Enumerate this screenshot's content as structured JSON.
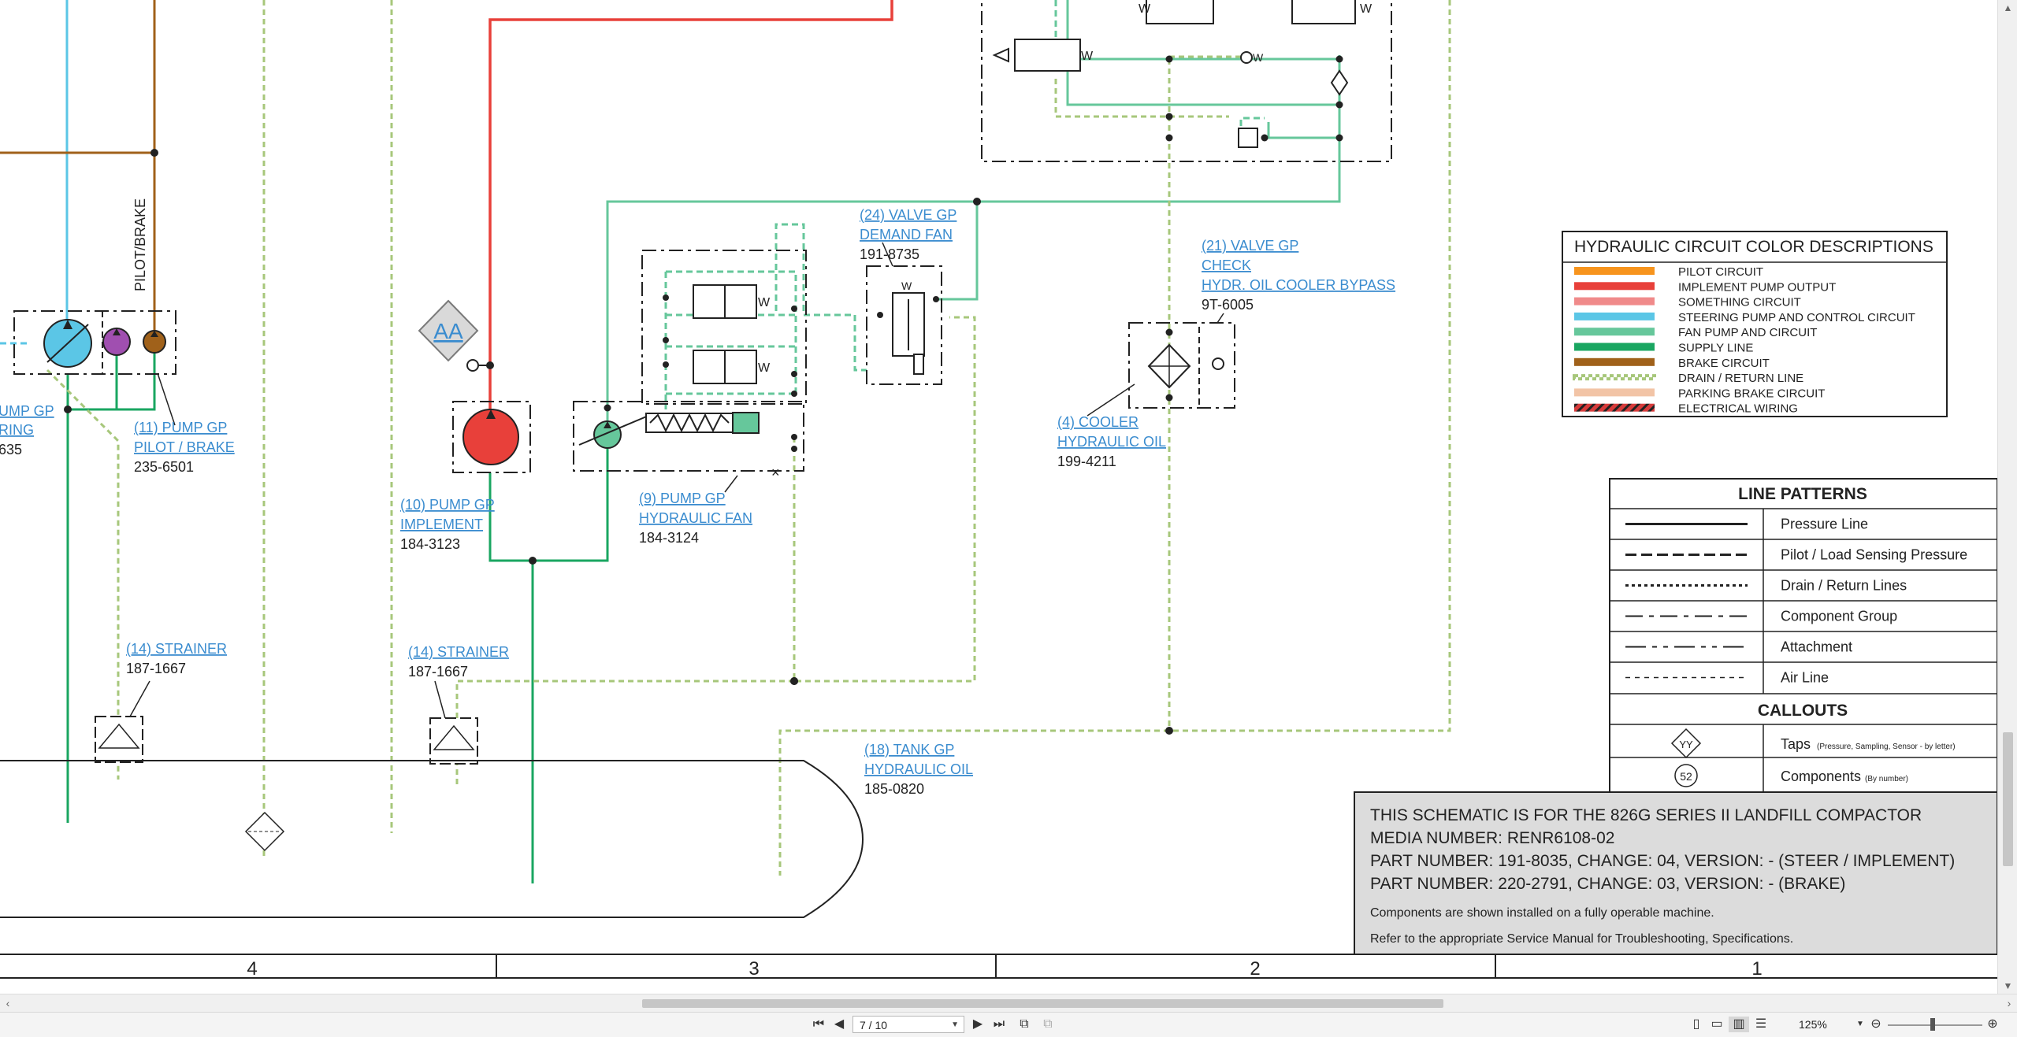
{
  "colors": {
    "pilot": "#f7941d",
    "implement": "#e8403a",
    "something": "#f08a8a",
    "steering": "#5bc6e6",
    "fan": "#66c79b",
    "supply": "#1aa661",
    "brake": "#a0611a",
    "drain": "#a7c77b",
    "parking": "#f2c4a6",
    "electrical": "#d73b3b",
    "link": "#3a8ccf"
  },
  "components": {
    "pump_steering": {
      "name1": "UMP GP",
      "name2": "RING",
      "part": "635"
    },
    "pump_pilot": {
      "name1": "(11) PUMP GP",
      "name2": "PILOT / BRAKE",
      "part": "235-6501"
    },
    "pilot_brake_label": "PILOT/BRAKE",
    "pump_implement": {
      "name1": "(10) PUMP GP",
      "name2": "IMPLEMENT",
      "part": "184-3123"
    },
    "pump_fan": {
      "name1": "(9) PUMP GP",
      "name2": "HYDRAULIC FAN",
      "part": "184-3124"
    },
    "valve_fan": {
      "name1": "(24) VALVE GP",
      "name2": "DEMAND FAN",
      "part": "191-8735"
    },
    "valve_check": {
      "name1": "(21) VALVE GP",
      "name2": "CHECK",
      "name3": "HYDR. OIL COOLER BYPASS",
      "part": "9T-6005"
    },
    "cooler": {
      "name1": "(4) COOLER",
      "name2": "HYDRAULIC OIL",
      "part": "199-4211"
    },
    "strainer_a": {
      "name1": "(14) STRAINER",
      "part": "187-1667"
    },
    "strainer_b": {
      "name1": "(14) STRAINER",
      "part": "187-1667"
    },
    "tank": {
      "name1": "(18) TANK GP",
      "name2": "HYDRAULIC OIL",
      "part": "185-0820"
    },
    "tap_aa": "AA"
  },
  "color_legend": {
    "title": "HYDRAULIC CIRCUIT COLOR DESCRIPTIONS",
    "items": [
      {
        "label": "PILOT CIRCUIT",
        "color": "#f7941d"
      },
      {
        "label": "IMPLEMENT PUMP OUTPUT",
        "color": "#e8403a"
      },
      {
        "label": "SOMETHING CIRCUIT",
        "color": "#f08a8a"
      },
      {
        "label": "STEERING PUMP AND CONTROL CIRCUIT",
        "color": "#5bc6e6"
      },
      {
        "label": "FAN PUMP AND CIRCUIT",
        "color": "#66c79b"
      },
      {
        "label": "SUPPLY LINE",
        "color": "#1aa661"
      },
      {
        "label": "BRAKE CIRCUIT",
        "color": "#a0611a"
      },
      {
        "label": "DRAIN / RETURN LINE",
        "color": "#a7c77b"
      },
      {
        "label": "PARKING BRAKE CIRCUIT",
        "color": "#f2c4a6"
      },
      {
        "label": "ELECTRICAL WIRING",
        "color": "#d73b3b"
      }
    ]
  },
  "line_patterns": {
    "title": "LINE PATTERNS",
    "items": [
      "Pressure Line",
      "Pilot / Load Sensing Pressure",
      "Drain / Return Lines",
      "Component Group",
      "Attachment",
      "Air Line"
    ],
    "callouts_title": "CALLOUTS",
    "tap_symbol": "YY",
    "tap_label": "Taps",
    "tap_note": "(Pressure, Sampling, Sensor - by letter)",
    "comp_symbol": "52",
    "comp_label": "Components",
    "comp_note": "(By number)"
  },
  "info_box": {
    "line1": "THIS SCHEMATIC IS FOR THE 826G SERIES II LANDFILL COMPACTOR",
    "line2": "MEDIA NUMBER: RENR6108-02",
    "line3": "PART NUMBER: 191-8035, CHANGE: 04, VERSION: - (STEER / IMPLEMENT)",
    "line4": "PART NUMBER: 220-2791, CHANGE: 03, VERSION: - (BRAKE)",
    "line5": "Components are shown installed on a fully operable machine.",
    "line6": "Refer to the appropriate Service Manual for Troubleshooting, Specifications."
  },
  "grid_numbers": [
    "4",
    "3",
    "2",
    "1"
  ],
  "toolbar": {
    "page": "7 / 10",
    "zoom": "125%"
  }
}
